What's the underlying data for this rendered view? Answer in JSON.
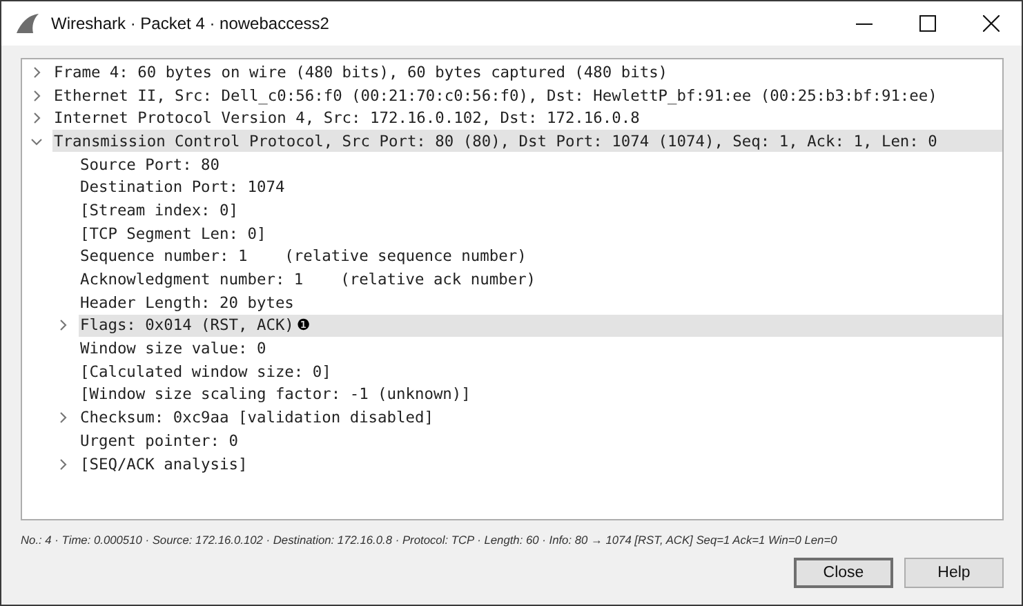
{
  "window": {
    "title": "Wireshark · Packet 4 · nowebaccess2"
  },
  "tree": [
    {
      "label": "Frame 4: 60 bytes on wire (480 bits), 60 bytes captured (480 bits)",
      "expanded": false,
      "highlighted": false
    },
    {
      "label": "Ethernet II, Src: Dell_c0:56:f0 (00:21:70:c0:56:f0), Dst: HewlettP_bf:91:ee (00:25:b3:bf:91:ee)",
      "expanded": false,
      "highlighted": false
    },
    {
      "label": "Internet Protocol Version 4, Src: 172.16.0.102, Dst: 172.16.0.8",
      "expanded": false,
      "highlighted": false
    },
    {
      "label": "Transmission Control Protocol, Src Port: 80 (80), Dst Port: 1074 (1074), Seq: 1, Ack: 1, Len: 0",
      "expanded": true,
      "highlighted": true,
      "children": [
        {
          "label": "Source Port: 80",
          "highlighted": false
        },
        {
          "label": "Destination Port: 1074",
          "highlighted": false
        },
        {
          "label": "[Stream index: 0]",
          "highlighted": false
        },
        {
          "label": "[TCP Segment Len: 0]",
          "highlighted": false
        },
        {
          "label": "Sequence number: 1    (relative sequence number)",
          "highlighted": false
        },
        {
          "label": "Acknowledgment number: 1    (relative ack number)",
          "highlighted": false
        },
        {
          "label": "Header Length: 20 bytes",
          "highlighted": false
        },
        {
          "label": "Flags: 0x014 (RST, ACK)",
          "expanded": false,
          "highlighted": true,
          "callout": "❶"
        },
        {
          "label": "Window size value: 0",
          "highlighted": false
        },
        {
          "label": "[Calculated window size: 0]",
          "highlighted": false
        },
        {
          "label": "[Window size scaling factor: -1 (unknown)]",
          "highlighted": false
        },
        {
          "label": "Checksum: 0xc9aa [validation disabled]",
          "expanded": false,
          "highlighted": false
        },
        {
          "label": "Urgent pointer: 0",
          "highlighted": false
        },
        {
          "label": "[SEQ/ACK analysis]",
          "expanded": false,
          "highlighted": false
        }
      ]
    }
  ],
  "status_line": "No.: 4 · Time: 0.000510 · Source: 172.16.0.102 · Destination: 172.16.0.8 · Protocol: TCP · Length: 60 · Info: 80 → 1074 [RST, ACK] Seq=1 Ack=1 Win=0 Len=0",
  "buttons": [
    {
      "label": "Close",
      "selected": true
    },
    {
      "label": "Help",
      "selected": false
    }
  ]
}
